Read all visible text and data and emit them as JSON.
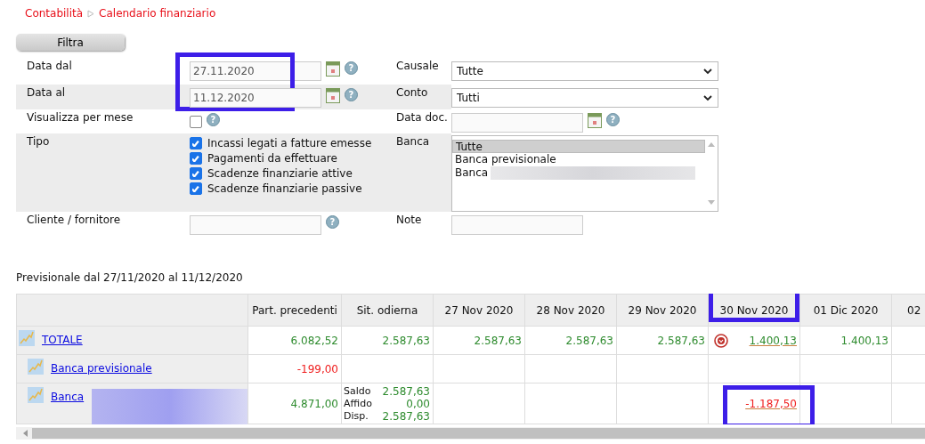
{
  "breadcrumb": [
    {
      "label": "Contabilità"
    },
    {
      "label": "Calendario finanziario"
    }
  ],
  "filter_button": "Filtra",
  "form": {
    "rows": [
      {
        "left": {
          "label": "Data dal",
          "kind": "date",
          "value": "27.11.2020",
          "help": "?",
          "highlighted": true
        },
        "right": {
          "label": "Causale",
          "kind": "select",
          "value": "Tutte"
        }
      },
      {
        "left": {
          "label": "Data al",
          "kind": "date",
          "value": "11.12.2020",
          "help": "?"
        },
        "right": {
          "label": "Conto",
          "kind": "select",
          "value": "Tutti"
        }
      },
      {
        "left": {
          "label": "Visualizza per mese",
          "kind": "checkbox",
          "checked": false,
          "help": "?"
        },
        "right": {
          "label": "Data doc.",
          "kind": "date",
          "help": "?"
        }
      },
      {
        "left": {
          "label": "Tipo",
          "kind": "checklist",
          "options": [
            {
              "label": "Incassi legati a fatture emesse",
              "checked": true
            },
            {
              "label": "Pagamenti da effettuare",
              "checked": true
            },
            {
              "label": "Scadenze finanziarie attive",
              "checked": true
            },
            {
              "label": "Scadenze finanziarie passive",
              "checked": true
            }
          ]
        },
        "right": {
          "label": "Banca",
          "kind": "listbox",
          "options": [
            {
              "label": "Tutte",
              "selected": true
            },
            {
              "label": "Banca previsionale",
              "selected": false
            },
            {
              "label": "Banca",
              "selected": false,
              "blurred": true
            }
          ]
        }
      },
      {
        "left": {
          "label": "Cliente / fornitore",
          "kind": "text",
          "help": "?"
        },
        "right": {
          "label": "Note",
          "kind": "text"
        }
      }
    ]
  },
  "forecast": {
    "title": "Previsionale dal 27/11/2020 al 11/12/2020",
    "columns": [
      {
        "label": "Part. precedenti"
      },
      {
        "label": "Sit. odierna"
      },
      {
        "label": "27 Nov 2020"
      },
      {
        "label": "28 Nov 2020"
      },
      {
        "label": "29 Nov 2020"
      },
      {
        "label": "30 Nov 2020",
        "highlighted": true
      },
      {
        "label": "01 Dic 2020"
      },
      {
        "label": "02"
      }
    ],
    "rows": [
      {
        "name": "TOTALE",
        "cells": [
          {
            "text": "6.082,52",
            "color": "#2e8b2e"
          },
          {
            "text": "2.587,63",
            "color": "#2e8b2e"
          },
          {
            "text": "2.587,63",
            "color": "#2e8b2e"
          },
          {
            "text": "2.587,63",
            "color": "#2e8b2e"
          },
          {
            "text": "2.587,63",
            "color": "#2e8b2e"
          },
          {
            "text": "1.400,13",
            "color": "#2e8b2e",
            "link": true,
            "alert": true
          },
          {
            "text": "1.400,13",
            "color": "#2e8b2e"
          },
          null
        ],
        "children": [
          {
            "name": "Banca previsionale",
            "cells": [
              {
                "text": "-199,00",
                "color": "#f02020"
              },
              null,
              null,
              null,
              null,
              null,
              null,
              null
            ]
          },
          {
            "name": "Banca",
            "blurred": true,
            "cells": [
              {
                "text": "4.871,00",
                "color": "#2e8b2e"
              },
              {
                "kind": "balance",
                "lines": [
                  {
                    "label": "Saldo",
                    "text": "2.587,63"
                  },
                  {
                    "label": "Affido",
                    "text": "0,00"
                  },
                  {
                    "label": "Disp.",
                    "text": "2.587,63"
                  }
                ]
              },
              null,
              null,
              null,
              {
                "text": "-1.187,50",
                "color": "#f02020",
                "link": true,
                "highlighted": true
              },
              null,
              null
            ]
          }
        ]
      }
    ]
  }
}
